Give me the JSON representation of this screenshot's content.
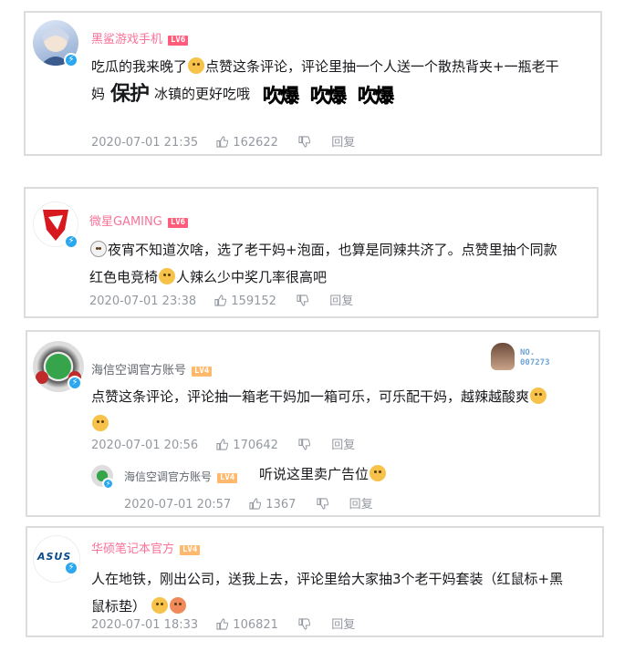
{
  "comments": [
    {
      "user": "黑鲨游戏手机",
      "level": "LV6",
      "text_a": "吃瓜的我来晚了",
      "text_b": "点赞这条评论，评论里抽一个人送一个散热背夹+一瓶老干",
      "text_c": "妈",
      "big_text": "保护",
      "text_d": "冰镇的更好吃哦",
      "burst_text": [
        "吹爆",
        "吹爆",
        "吹爆"
      ],
      "time": "2020-07-01 21:35",
      "likes": "162622",
      "reply": "回复"
    },
    {
      "user": "微星GAMING",
      "level": "LV6",
      "text_a": "夜宵不知道次啥，选了老干妈+泡面，也算是同辣共济了。点赞里抽个同款",
      "text_b": "红色电竞椅",
      "text_c": "人辣么少中奖几率很高吧",
      "time": "2020-07-01 23:38",
      "likes": "159152",
      "reply": "回复"
    },
    {
      "user": "海信空调官方账号",
      "level": "LV4",
      "no_label": "NO.",
      "no_number": "007273",
      "text_a": "点赞这条评论，评论抽一箱老干妈加一箱可乐，可乐配干妈，越辣越酸爽",
      "time": "2020-07-01 20:56",
      "likes": "170642",
      "reply": "回复",
      "sub": {
        "user": "海信空调官方账号",
        "level": "LV4",
        "text": "听说这里卖广告位",
        "time": "2020-07-01 20:57",
        "likes": "1367",
        "reply": "回复"
      }
    },
    {
      "user": "华硕笔记本官方",
      "level": "LV4",
      "avatar_text": "ASUS",
      "text_a": "人在地铁，刚出公司，送我上去，评论里给大家抽3个老干妈套装（红鼠标+黑",
      "text_b": "鼠标垫）",
      "time": "2020-07-01 18:33",
      "likes": "106821",
      "reply": "回复"
    }
  ],
  "colors": {
    "pink": "#fb7299",
    "gray_text": "#9499a0",
    "blue_badge": "#2ba7f0",
    "lv6": "#ff5c7c",
    "lv4": "#feb96c"
  },
  "icons": [
    "like-icon",
    "dislike-icon",
    "verified-icon",
    "emoji-icon"
  ]
}
